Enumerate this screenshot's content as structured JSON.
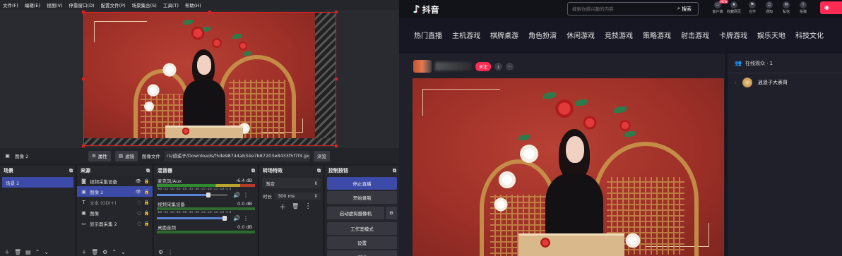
{
  "obs": {
    "menu": [
      "文件(F)",
      "编辑(E)",
      "视图(V)",
      "停靠窗口(D)",
      "配置文件(P)",
      "场景集合(S)",
      "工具(T)",
      "帮助(H)"
    ],
    "source_bar": {
      "selected_source": "图像 2",
      "properties_label": "属性",
      "filters_label": "滤镜",
      "image_file_label": "图像文件",
      "image_path": "rs/逍遥子/Downloads/f5de98744ab34e7b87203e8433f5f7f4.jpg",
      "browse_label": "浏览"
    },
    "scenes": {
      "title": "场景",
      "items": [
        "场景 2"
      ]
    },
    "sources": {
      "title": "来源",
      "items": [
        {
          "name": "视频采集设备",
          "icon": "camera-icon"
        },
        {
          "name": "图像 2",
          "icon": "image-icon"
        },
        {
          "name": "文本 (GDI+)",
          "icon": "text-icon"
        },
        {
          "name": "图像",
          "icon": "image-icon"
        },
        {
          "name": "显示器采集 2",
          "icon": "monitor-icon"
        }
      ]
    },
    "mixer": {
      "title": "混音器",
      "channels": [
        {
          "name": "麦克风/Aux",
          "db": "-6.4 dB",
          "volume": 0.72
        },
        {
          "name": "视频采集设备",
          "db": "0.0 dB",
          "volume": 0.95
        },
        {
          "name": "桌面音频",
          "db": "0.0 dB",
          "volume": 0.95
        }
      ],
      "ticks": "-60 -55 -50 -45 -40 -35 -30 -25 -20 -15 -10 -5 0"
    },
    "transitions": {
      "title": "转场特效",
      "type": "渐变",
      "duration_label": "时长",
      "duration": "300 ms"
    },
    "controls": {
      "title": "控制按钮",
      "stop_stream": "停止直播",
      "start_record": "开始录制",
      "start_virtualcam": "启动虚拟摄像机",
      "studio_mode": "工作室模式",
      "settings": "设置",
      "exit": "退出"
    }
  },
  "douyin": {
    "logo": "抖音",
    "search": {
      "placeholder": "搜索你感兴趣的内容",
      "button": "搜索"
    },
    "top_icons": [
      {
        "label": "客户端",
        "badge": "NEW"
      },
      {
        "label": "收藏网页"
      },
      {
        "label": "合作"
      },
      {
        "label": "通知"
      },
      {
        "label": "私信"
      },
      {
        "label": "投稿"
      }
    ],
    "nav": [
      "热门直播",
      "主机游戏",
      "棋牌桌游",
      "角色扮演",
      "休闲游戏",
      "竞技游戏",
      "策略游戏",
      "射击游戏",
      "卡牌游戏",
      "娱乐天地",
      "科技文化"
    ],
    "room": {
      "follow_label": "关注"
    },
    "online": {
      "title": "在线观众 · 1",
      "user": "逍遥子大表哥"
    },
    "colors": {
      "accent": "#fe2c55",
      "obs_selected": "#3c4aa8"
    }
  }
}
